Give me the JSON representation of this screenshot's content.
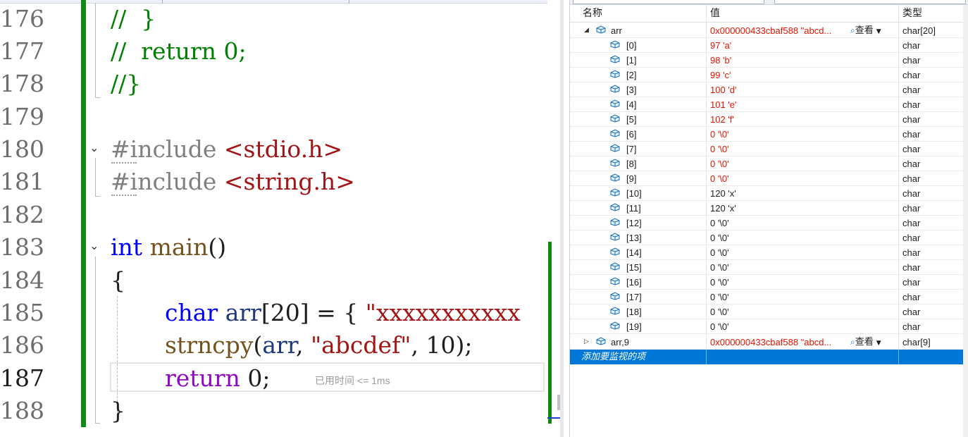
{
  "editor": {
    "lines": [
      {
        "num": "176",
        "text": "//  }"
      },
      {
        "num": "177",
        "text": "//  return 0;"
      },
      {
        "num": "178",
        "text": "//}"
      },
      {
        "num": "179",
        "text": ""
      },
      {
        "num": "180",
        "directive": "#include",
        "header": "<stdio.h>"
      },
      {
        "num": "181",
        "directive": "#include",
        "header": "<string.h>"
      },
      {
        "num": "182",
        "text": ""
      },
      {
        "num": "183",
        "kw": "int",
        "fn": "main",
        "rest": "()"
      },
      {
        "num": "184",
        "text": "{"
      },
      {
        "num": "185",
        "kw": "char",
        "var": "arr",
        "mid": "[20] = { ",
        "str": "\"xxxxxxxxxxx"
      },
      {
        "num": "186",
        "fn": "strncpy",
        "p1": "(",
        "var": "arr",
        "p2": ", ",
        "str": "\"abcdef\"",
        "p3": ", 10);"
      },
      {
        "num": "187",
        "kw": "return",
        "rest": " 0;"
      },
      {
        "num": "188",
        "text": "}"
      }
    ],
    "elapsed": "已用时间 <= 1ms"
  },
  "watch": {
    "headers": {
      "name": "名称",
      "value": "值",
      "type": "类型"
    },
    "arr": {
      "name": "arr",
      "value": "0x000000433cbaf588 \"abcd...",
      "viewer": "查看",
      "type": "char[20]"
    },
    "items": [
      {
        "name": "[0]",
        "value": "97 'a'",
        "type": "char",
        "changed": true
      },
      {
        "name": "[1]",
        "value": "98 'b'",
        "type": "char",
        "changed": true
      },
      {
        "name": "[2]",
        "value": "99 'c'",
        "type": "char",
        "changed": true
      },
      {
        "name": "[3]",
        "value": "100 'd'",
        "type": "char",
        "changed": true
      },
      {
        "name": "[4]",
        "value": "101 'e'",
        "type": "char",
        "changed": true
      },
      {
        "name": "[5]",
        "value": "102 'f'",
        "type": "char",
        "changed": true
      },
      {
        "name": "[6]",
        "value": "0 '\\0'",
        "type": "char",
        "changed": true
      },
      {
        "name": "[7]",
        "value": "0 '\\0'",
        "type": "char",
        "changed": true
      },
      {
        "name": "[8]",
        "value": "0 '\\0'",
        "type": "char",
        "changed": true
      },
      {
        "name": "[9]",
        "value": "0 '\\0'",
        "type": "char",
        "changed": true
      },
      {
        "name": "[10]",
        "value": "120 'x'",
        "type": "char",
        "changed": false
      },
      {
        "name": "[11]",
        "value": "120 'x'",
        "type": "char",
        "changed": false
      },
      {
        "name": "[12]",
        "value": "0 '\\0'",
        "type": "char",
        "changed": false
      },
      {
        "name": "[13]",
        "value": "0 '\\0'",
        "type": "char",
        "changed": false
      },
      {
        "name": "[14]",
        "value": "0 '\\0'",
        "type": "char",
        "changed": false
      },
      {
        "name": "[15]",
        "value": "0 '\\0'",
        "type": "char",
        "changed": false
      },
      {
        "name": "[16]",
        "value": "0 '\\0'",
        "type": "char",
        "changed": false
      },
      {
        "name": "[17]",
        "value": "0 '\\0'",
        "type": "char",
        "changed": false
      },
      {
        "name": "[18]",
        "value": "0 '\\0'",
        "type": "char",
        "changed": false
      },
      {
        "name": "[19]",
        "value": "0 '\\0'",
        "type": "char",
        "changed": false
      }
    ],
    "arr9": {
      "name": "arr,9",
      "value": "0x000000433cbaf588 \"abcd...",
      "viewer": "查看",
      "type": "char[9]"
    },
    "add_placeholder": "添加要监视的项",
    "colors": {
      "changed": "#e51400",
      "selection": "#0078d7",
      "change_bar": "#108a10"
    },
    "icons": [
      "expand-collapse-arrow-icon",
      "variable-cube-icon",
      "magnifier-viewer-icon",
      "dropdown-arrow-icon"
    ]
  }
}
